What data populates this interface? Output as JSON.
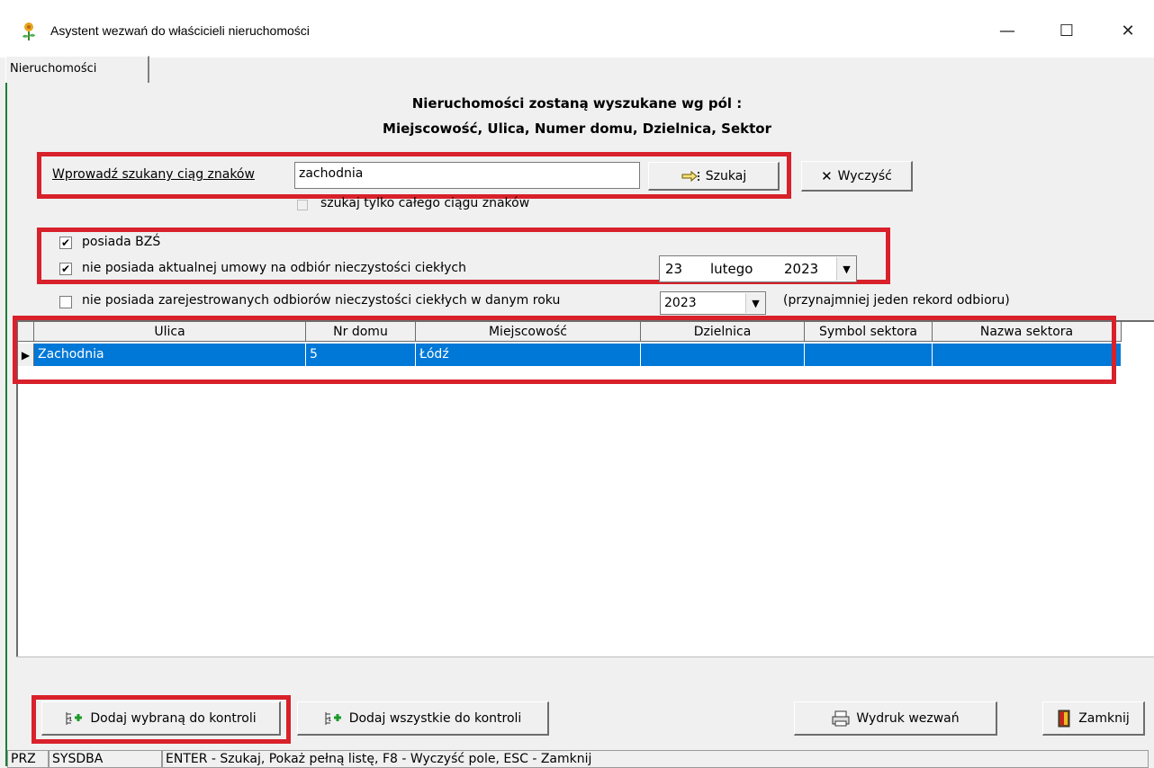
{
  "window": {
    "title": "Asystent wezwań do właścicieli nieruchomości",
    "min_glyph": "—",
    "max_glyph": "☐",
    "close_glyph": "✕"
  },
  "tab": {
    "label": "Nieruchomości"
  },
  "heading": {
    "line1": "Nieruchomości zostaną wyszukane wg pól :",
    "line2": "Miejscowość, Ulica, Numer domu, Dzielnica, Sektor"
  },
  "search": {
    "label": "Wprowadź szukany ciąg znaków",
    "value": "zachodnia",
    "search_button": "Szukaj",
    "clear_button": "Wyczyść",
    "whole_string_label": "szukaj tylko całego ciągu znaków"
  },
  "filters": {
    "has_bzs": "posiada BZŚ",
    "no_contract": "nie posiada aktualnej umowy na odbiór nieczystości ciekłych",
    "no_registered": "nie posiada zarejestrowanych odbiorów nieczystości ciekłych w danym roku",
    "date_day": "23",
    "date_month": "lutego",
    "date_year": "2023",
    "year_value": "2023",
    "year_note": "(przynajmniej jeden rekord odbioru)",
    "checkmark": "✔"
  },
  "grid": {
    "columns": [
      "Ulica",
      "Nr domu",
      "Miejscowość",
      "Dzielnica",
      "Symbol sektora",
      "Nazwa sektora"
    ],
    "rows": [
      {
        "ulica": "Zachodnia",
        "nr_domu": "5",
        "miejscowosc": "Łódź",
        "dzielnica": "",
        "symbol_sektora": "",
        "nazwa_sektora": ""
      }
    ]
  },
  "actions": {
    "add_selected": "Dodaj wybraną do kontroli",
    "add_all": "Dodaj wszystkie do kontroli",
    "print": "Wydruk wezwań",
    "close": "Zamknij"
  },
  "status": {
    "cell1": "PRZ",
    "cell2": "SYSDBA",
    "cell3": "ENTER - Szukaj, Pokaż pełną listę, F8 - Wyczyść pole, ESC - Zamknij"
  },
  "colors": {
    "highlight_red": "#d8212a",
    "selection_blue": "#0078d7"
  }
}
